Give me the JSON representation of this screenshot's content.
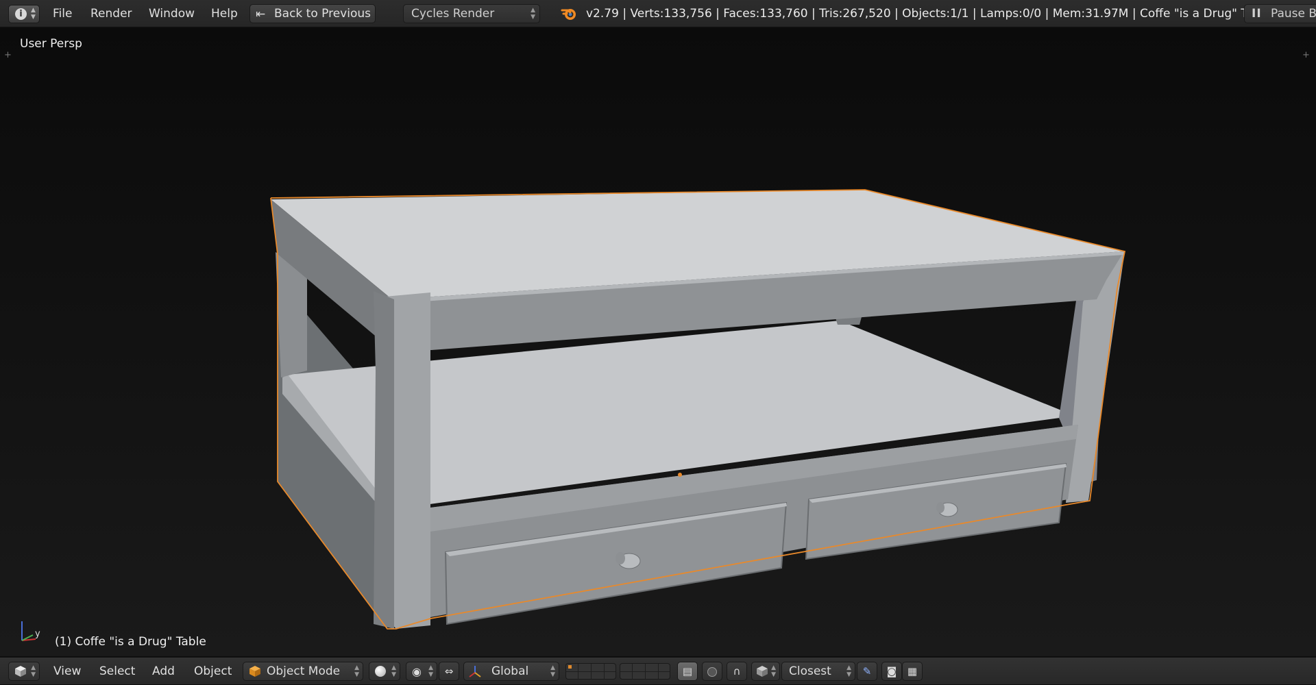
{
  "top_header": {
    "editor_type_icon": "info-icon",
    "menus": [
      "File",
      "Render",
      "Window",
      "Help"
    ],
    "back_button": {
      "icon": "back-arrow-icon",
      "label": "Back to Previous"
    },
    "render_engine": "Cycles Render",
    "logo_icon": "blender-logo-icon",
    "stats": "v2.79 | Verts:133,756 | Faces:133,760 | Tris:267,520 | Objects:1/1 | Lamps:0/0 | Mem:31.97M | Coffe \"is a Drug\" Table",
    "pause_button": {
      "icon": "pause-icon",
      "label": "Pause Bl"
    }
  },
  "viewport": {
    "view_name": "User Persp",
    "object_info": "(1) Coffe \"is a Drug\" Table",
    "axis_labels": {
      "y": "y"
    },
    "selection_color": "#e8892b",
    "model_color": "#a7aaad"
  },
  "bottom_header": {
    "editor_type_icon": "3d-view-cube-icon",
    "menus": [
      "View",
      "Select",
      "Add",
      "Object"
    ],
    "mode": {
      "icon": "object-mode-cube-icon",
      "label": "Object Mode"
    },
    "shading_icon": "solid-shading-sphere-icon",
    "pivot_icon": "pivot-point-icon",
    "manipulator_icon": "translate-manipulator-icon",
    "orientation": {
      "icon": "transform-orientation-icon",
      "label": "Global"
    },
    "layers_icon": "scene-layers-grid",
    "lock_icon": "lock-camera-icon",
    "proportional_icon": "proportional-edit-icon",
    "snap_icon": "magnet-snap-icon",
    "snap_element_icon": "snap-element-cube-icon",
    "snap_target": "Closest",
    "opengl_render_icon": "opengl-render-icon",
    "render_image_icon": "camera-render-icon",
    "render_anim_icon": "clapper-render-icon"
  }
}
